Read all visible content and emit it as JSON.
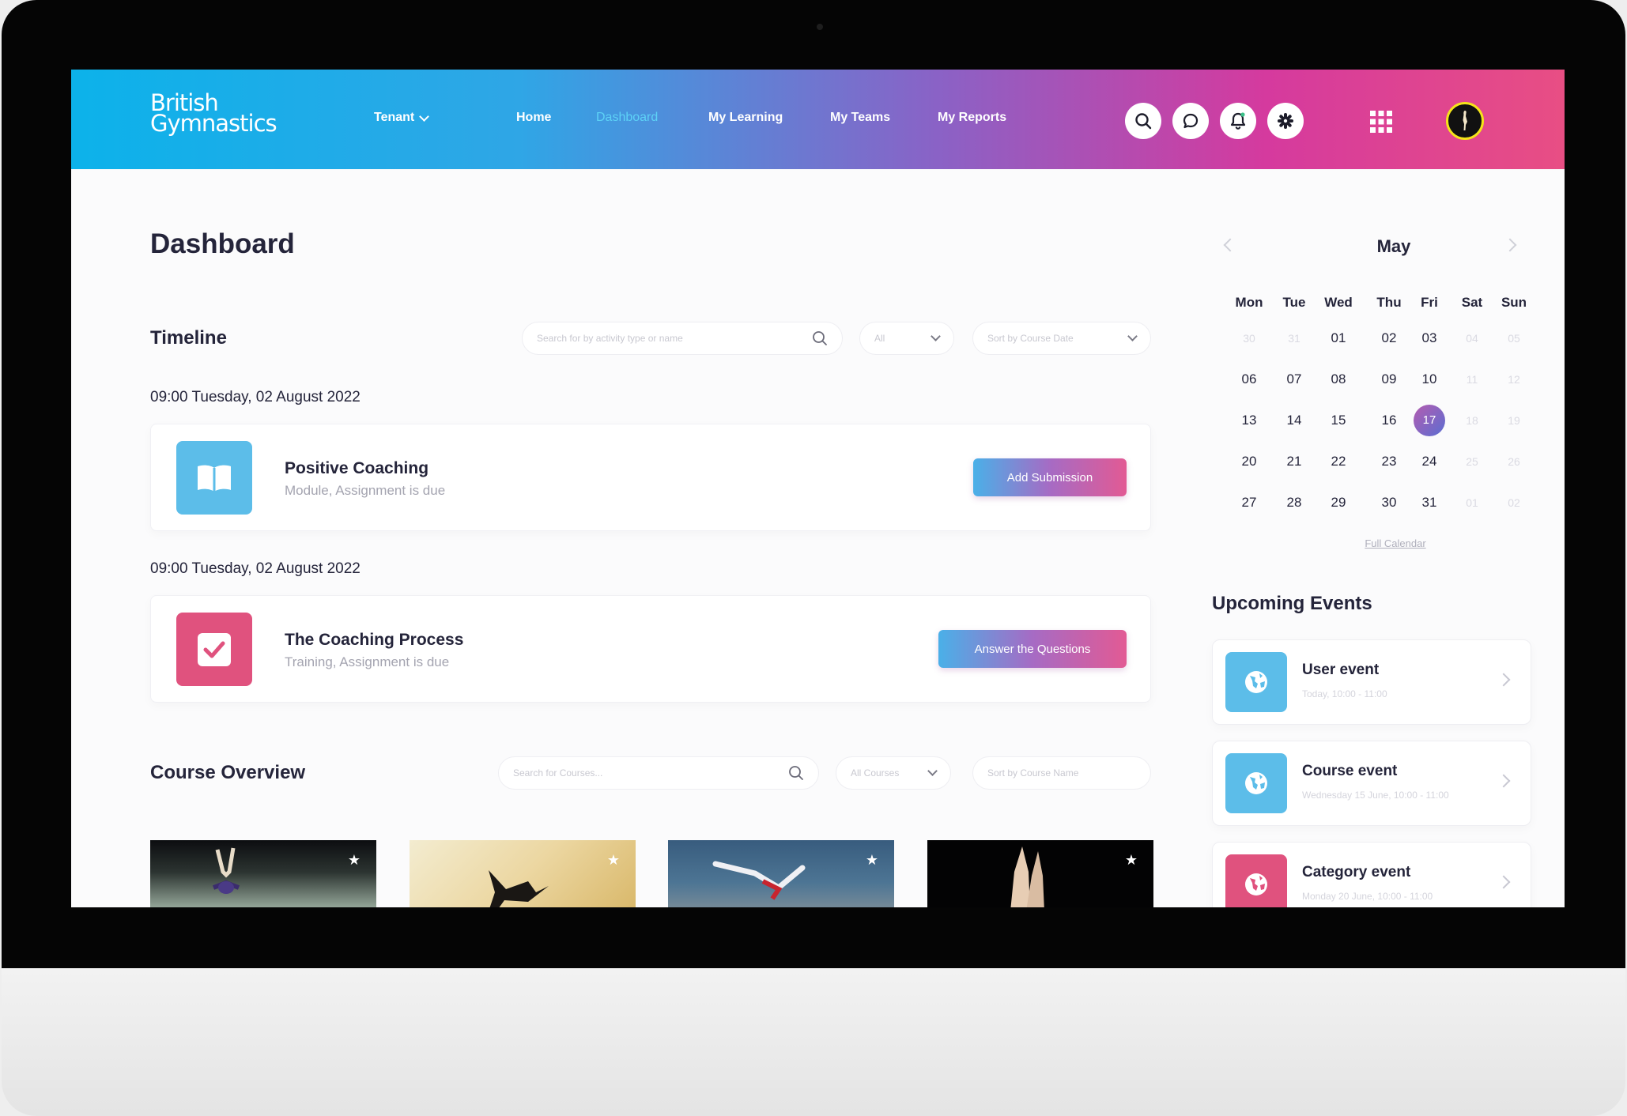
{
  "brand": {
    "logo_line1": "British",
    "logo_line2": "Gymnastics"
  },
  "nav": {
    "tenant": "Tenant",
    "links": [
      "Home",
      "Dashboard",
      "My Learning",
      "My Teams",
      "My Reports"
    ],
    "active": "Dashboard",
    "icons": [
      "search-icon",
      "chat-icon",
      "bell-icon",
      "gear-icon",
      "apps-grid-icon",
      "avatar"
    ]
  },
  "page": {
    "title": "Dashboard"
  },
  "timeline": {
    "title": "Timeline",
    "search_placeholder": "Search for by activity type or name",
    "filter": "All",
    "sort": "Sort by Course Date",
    "items": [
      {
        "date": "09:00 Tuesday, 02 August 2022",
        "title": "Positive Coaching",
        "subtitle": "Module, Assignment is due",
        "action": "Add Submission",
        "icon": "book-icon"
      },
      {
        "date": "09:00 Tuesday, 02 August 2022",
        "title": "The Coaching Process",
        "subtitle": "Training, Assignment is due",
        "action": "Answer the Questions",
        "icon": "checkbox-icon"
      }
    ]
  },
  "courses": {
    "title": "Course Overview",
    "search_placeholder": "Search for Courses...",
    "filter": "All Courses",
    "sort": "Sort by Course Name"
  },
  "calendar": {
    "month": "May",
    "weekdays": [
      "Mon",
      "Tue",
      "Wed",
      "Thu",
      "Fri",
      "Sat",
      "Sun"
    ],
    "weeks": [
      [
        "30",
        "31",
        "01",
        "02",
        "03",
        "04",
        "05"
      ],
      [
        "06",
        "07",
        "08",
        "09",
        "10",
        "11",
        "12"
      ],
      [
        "13",
        "14",
        "15",
        "16",
        "17",
        "18",
        "19"
      ],
      [
        "20",
        "21",
        "22",
        "23",
        "24",
        "25",
        "26"
      ],
      [
        "27",
        "28",
        "29",
        "30",
        "31",
        "01",
        "02"
      ]
    ],
    "today": "17",
    "full_calendar": "Full Calendar"
  },
  "events": {
    "title": "Upcoming Events",
    "items": [
      {
        "title": "User event",
        "time": "Today, 10:00 - 11:00",
        "color": "#5cbde9"
      },
      {
        "title": "Course event",
        "time": "Wednesday 15 June, 10:00 - 11:00",
        "color": "#5cbde9"
      },
      {
        "title": "Category event",
        "time": "Monday 20 June, 10:00 - 11:00",
        "color": "#e0527e"
      }
    ]
  },
  "colors": {
    "accent_blue": "#5cbde9",
    "accent_pink": "#e0527e",
    "text_dark": "#24243a"
  }
}
